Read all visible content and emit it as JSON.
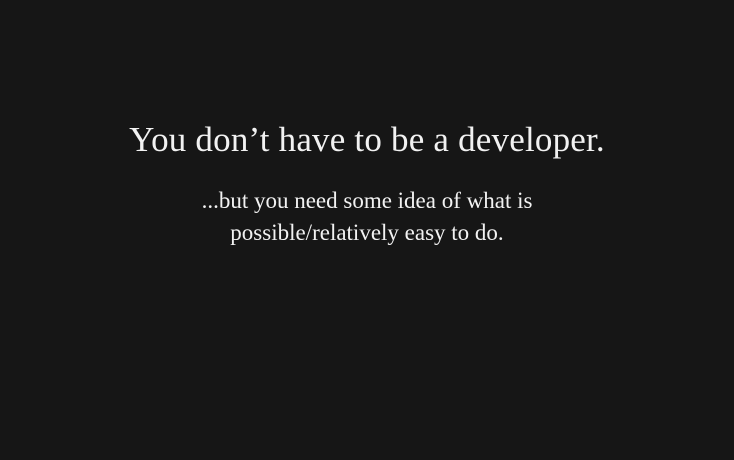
{
  "slide": {
    "title": "You don’t have to be a developer.",
    "subtitle_lines": [
      "...but you need some idea of what is",
      "possible/relatively easy to do."
    ]
  },
  "colors": {
    "background": "#161616",
    "text": "#f2f2f2"
  }
}
